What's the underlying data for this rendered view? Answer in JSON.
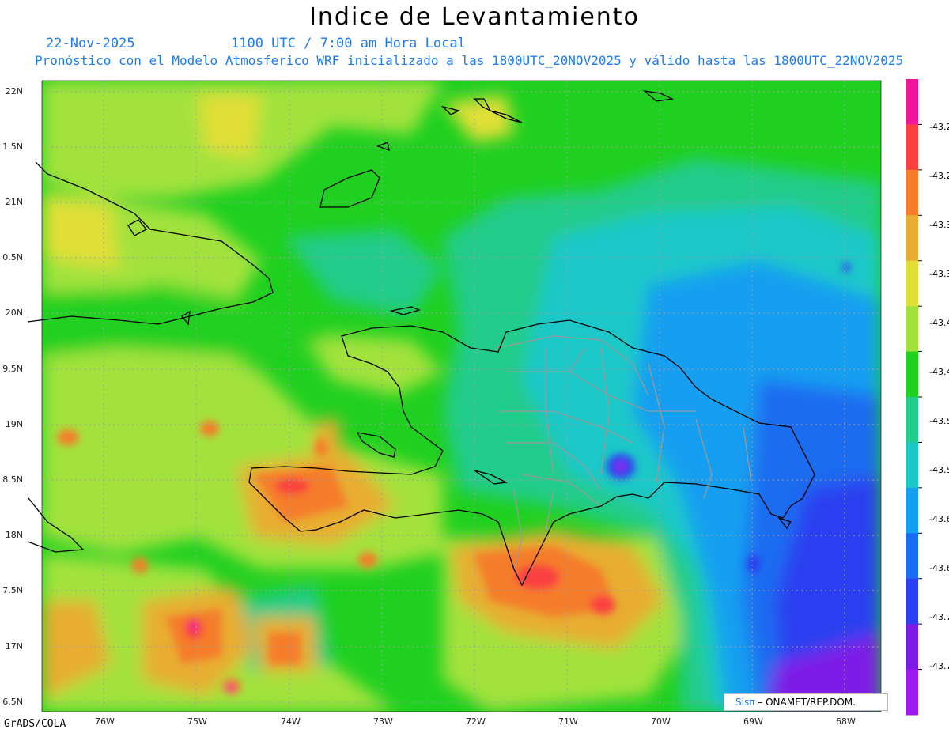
{
  "title": "Indice de Levantamiento",
  "header": {
    "date": "22-Nov-2025",
    "time": "1100 UTC / 7:00 am Hora Local",
    "description": "Pronóstico con el Modelo Atmosferico WRF inicializado a las 1800UTC_20NOV2025 y válido hasta las  1800UTC_22NOV2025"
  },
  "axes": {
    "lat_labels": [
      "22N",
      "1.5N",
      "21N",
      "0.5N",
      "20N",
      "9.5N",
      "19N",
      "8.5N",
      "18N",
      "7.5N",
      "17N",
      "6.5N"
    ],
    "lon_labels": [
      "76W",
      "75W",
      "74W",
      "73W",
      "72W",
      "71W",
      "70W",
      "69W",
      "68W"
    ]
  },
  "legend": {
    "colors": [
      "#f0169c",
      "#fa4040",
      "#f57d29",
      "#e8ad32",
      "#e1df37",
      "#a3e23c",
      "#20d020",
      "#22cc8a",
      "#1ac8c8",
      "#169ff0",
      "#1a6cf0",
      "#2a3ff0",
      "#7d1ae6",
      "#9d1aee"
    ],
    "labels": [
      "-43.2",
      "-43.2",
      "-43.3",
      "-43.3",
      "-43.4",
      "-43.4",
      "-43.5",
      "-43.5",
      "-43.6",
      "-43.6",
      "-43.7",
      "-43.7"
    ]
  },
  "footer": "GrADS/COLA",
  "credit": {
    "sis": "Sisπ",
    "text": "– ONAMET/REP.DOM."
  }
}
